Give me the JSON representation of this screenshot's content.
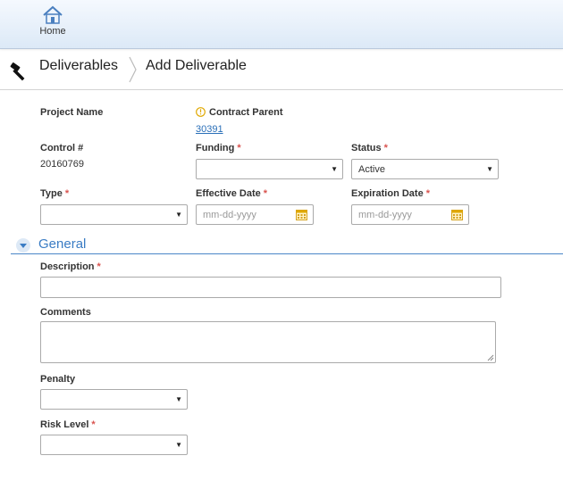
{
  "nav": {
    "home_label": "Home"
  },
  "breadcrumb": {
    "parent": "Deliverables",
    "current": "Add Deliverable"
  },
  "form": {
    "project_name_label": "Project Name",
    "contract_parent_label": "Contract Parent",
    "contract_parent_value": "30391",
    "control_label": "Control #",
    "control_value": "20160769",
    "funding_label": "Funding",
    "funding_value": "",
    "status_label": "Status",
    "status_value": "Active",
    "type_label": "Type",
    "type_value": "",
    "effective_date_label": "Effective Date",
    "effective_date_placeholder": "mm-dd-yyyy",
    "expiration_date_label": "Expiration Date",
    "expiration_date_placeholder": "mm-dd-yyyy",
    "required_mark": "*"
  },
  "general": {
    "title": "General",
    "description_label": "Description",
    "description_value": "",
    "comments_label": "Comments",
    "comments_value": "",
    "penalty_label": "Penalty",
    "penalty_value": "",
    "risk_level_label": "Risk Level",
    "risk_level_value": ""
  },
  "colors": {
    "accent": "#3a7cc4",
    "required": "#d9534f",
    "link": "#2a6fb8",
    "info_icon": "#e0a800"
  },
  "icons": {
    "home": "home-icon",
    "hammer": "hammer-icon",
    "info": "info-icon",
    "calendar": "calendar-icon",
    "collapse": "chevron-down-icon"
  }
}
